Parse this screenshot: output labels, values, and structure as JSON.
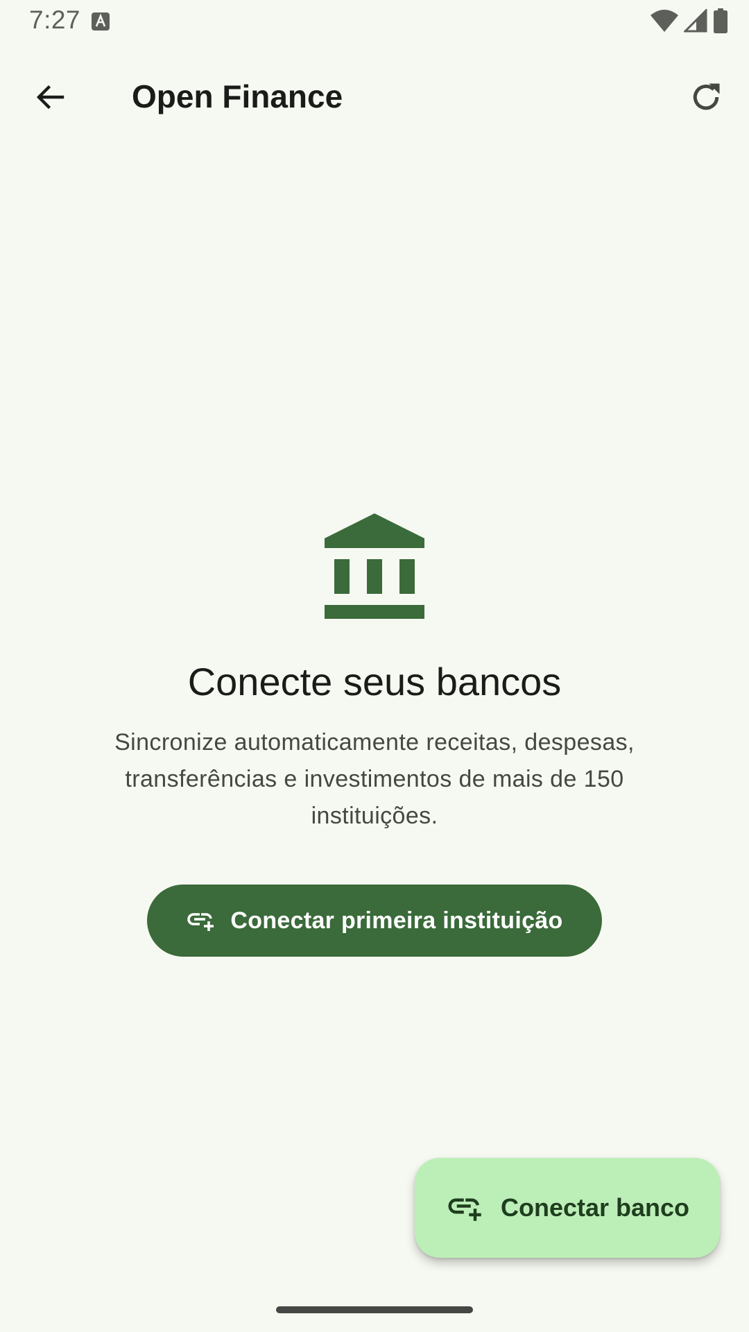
{
  "status_bar": {
    "time": "7:27"
  },
  "app_bar": {
    "title": "Open Finance"
  },
  "empty_state": {
    "title": "Conecte seus bancos",
    "description": "Sincronize automaticamente receitas, despesas, transferências e investimentos de mais de 150 instituições.",
    "primary_button_label": "Conectar primeira instituição"
  },
  "fab": {
    "label": "Conectar banco"
  },
  "icons": {
    "back": "arrow-back-icon",
    "refresh": "refresh-icon",
    "bank": "bank-icon",
    "add_link": "add-link-icon"
  },
  "colors": {
    "background": "#f6f9f1",
    "primary": "#3b6a3b",
    "fab_container": "#bcefb8",
    "on_fab": "#1f3d1f"
  }
}
